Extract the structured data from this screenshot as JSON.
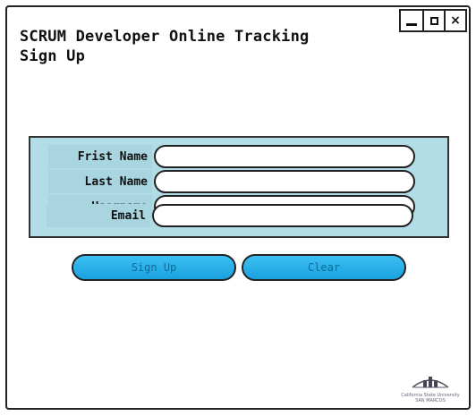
{
  "window": {
    "controls": {
      "minimize": "minimize",
      "maximize": "maximize",
      "close": "×"
    }
  },
  "header": {
    "title_line1": "SCRUM Developer Online Tracking",
    "title_line2": "Sign Up"
  },
  "form": {
    "fields": [
      {
        "label": "Frist Name",
        "value": ""
      },
      {
        "label": "Last Name",
        "value": ""
      },
      {
        "label": "Username",
        "value": ""
      },
      {
        "label": "Email",
        "value": ""
      }
    ]
  },
  "actions": {
    "signup_label": "Sign Up",
    "clear_label": "Clear"
  },
  "footer": {
    "logo_line1": "California State University",
    "logo_line2": "SAN MARCOS"
  }
}
